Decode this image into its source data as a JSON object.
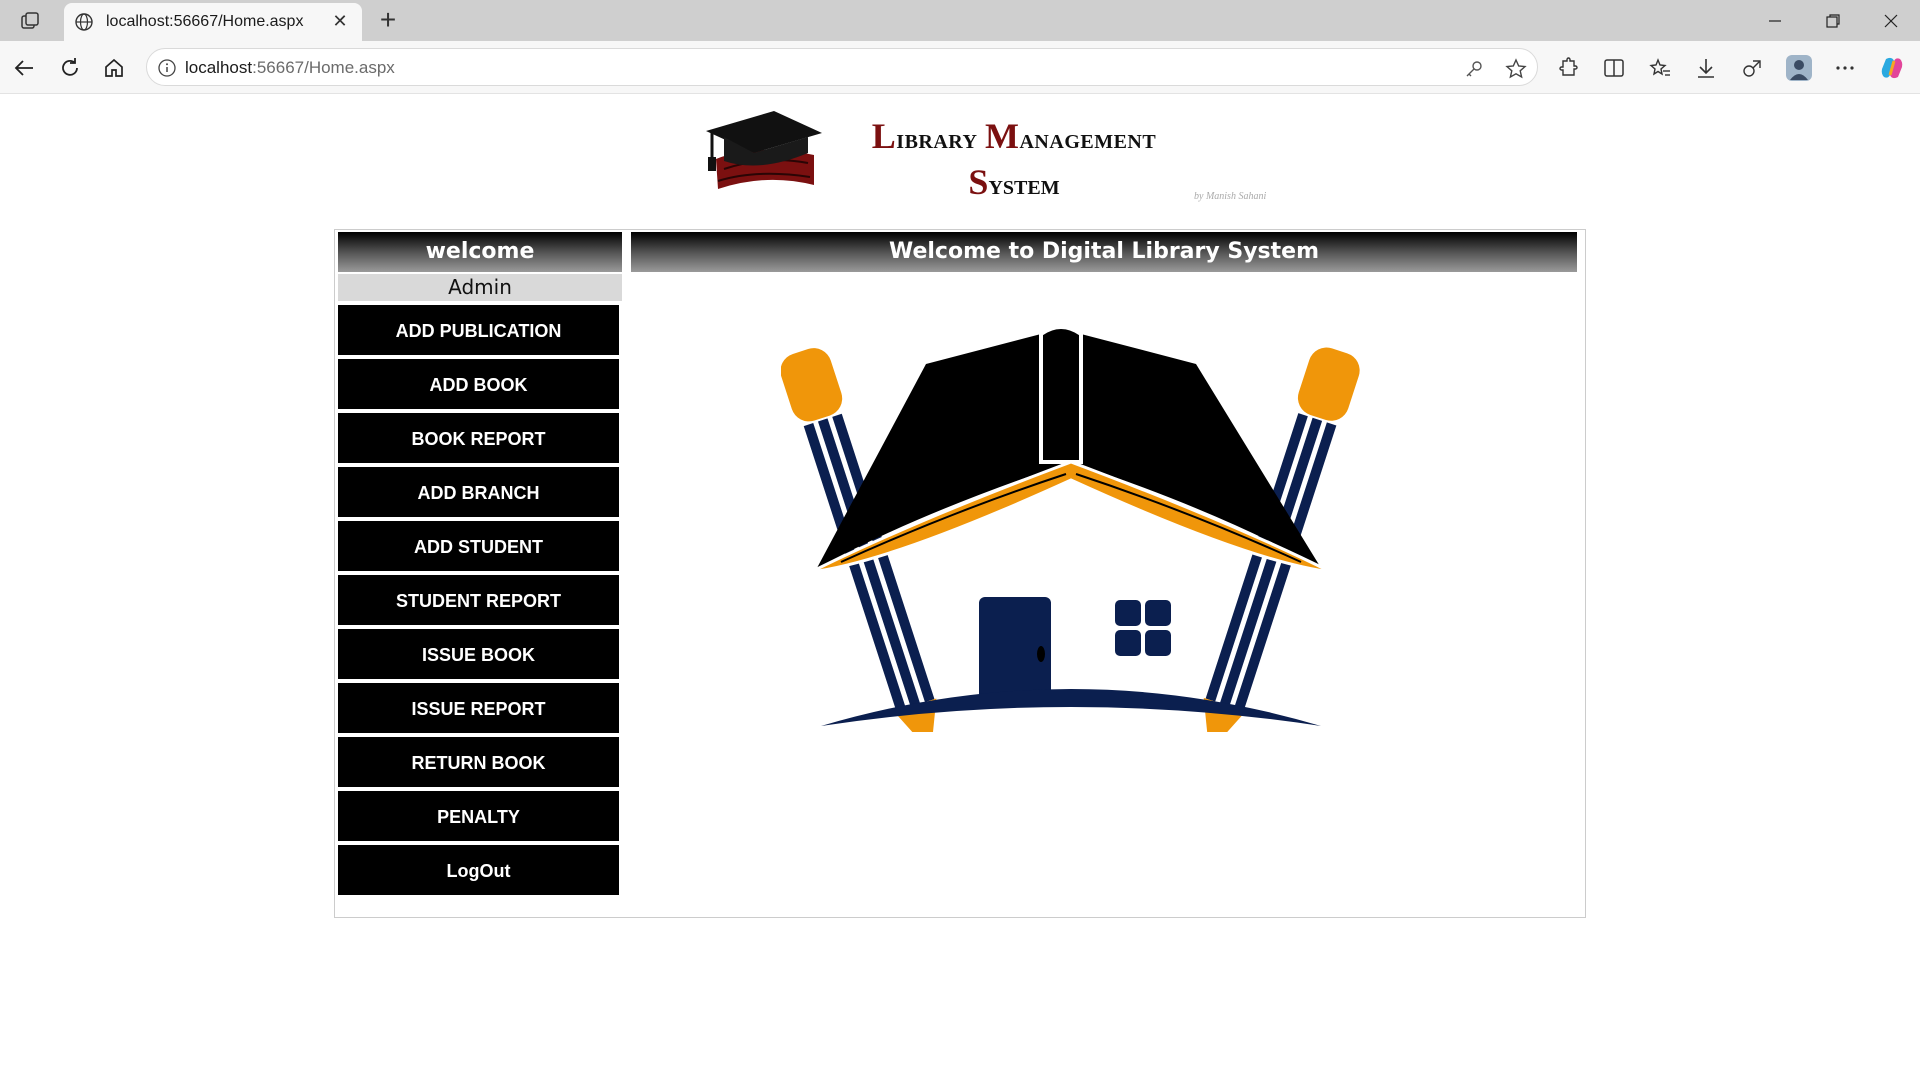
{
  "browser": {
    "tab_title": "localhost:56667/Home.aspx",
    "url_host": "localhost",
    "url_rest": ":56667/Home.aspx"
  },
  "header": {
    "logo_line1_cap1": "L",
    "logo_line1_rest1": "ibrary ",
    "logo_line1_cap2": "M",
    "logo_line1_rest2": "anagement",
    "logo_line2_cap": "S",
    "logo_line2_rest": "ystem",
    "byline": "by Manish Sahani"
  },
  "sidebar": {
    "heading": "welcome",
    "user": "Admin",
    "items": [
      {
        "label": "ADD PUBLICATION"
      },
      {
        "label": "ADD BOOK"
      },
      {
        "label": "BOOK REPORT"
      },
      {
        "label": "ADD BRANCH"
      },
      {
        "label": "ADD STUDENT"
      },
      {
        "label": "STUDENT REPORT"
      },
      {
        "label": "ISSUE BOOK"
      },
      {
        "label": "ISSUE REPORT"
      },
      {
        "label": "RETURN BOOK"
      },
      {
        "label": "PENALTY"
      },
      {
        "label": "LogOut"
      }
    ]
  },
  "main": {
    "heading": "Welcome to Digital Library System"
  },
  "colors": {
    "brand_red": "#7b1010",
    "orange": "#f0960a",
    "navy": "#0b1f4f"
  }
}
